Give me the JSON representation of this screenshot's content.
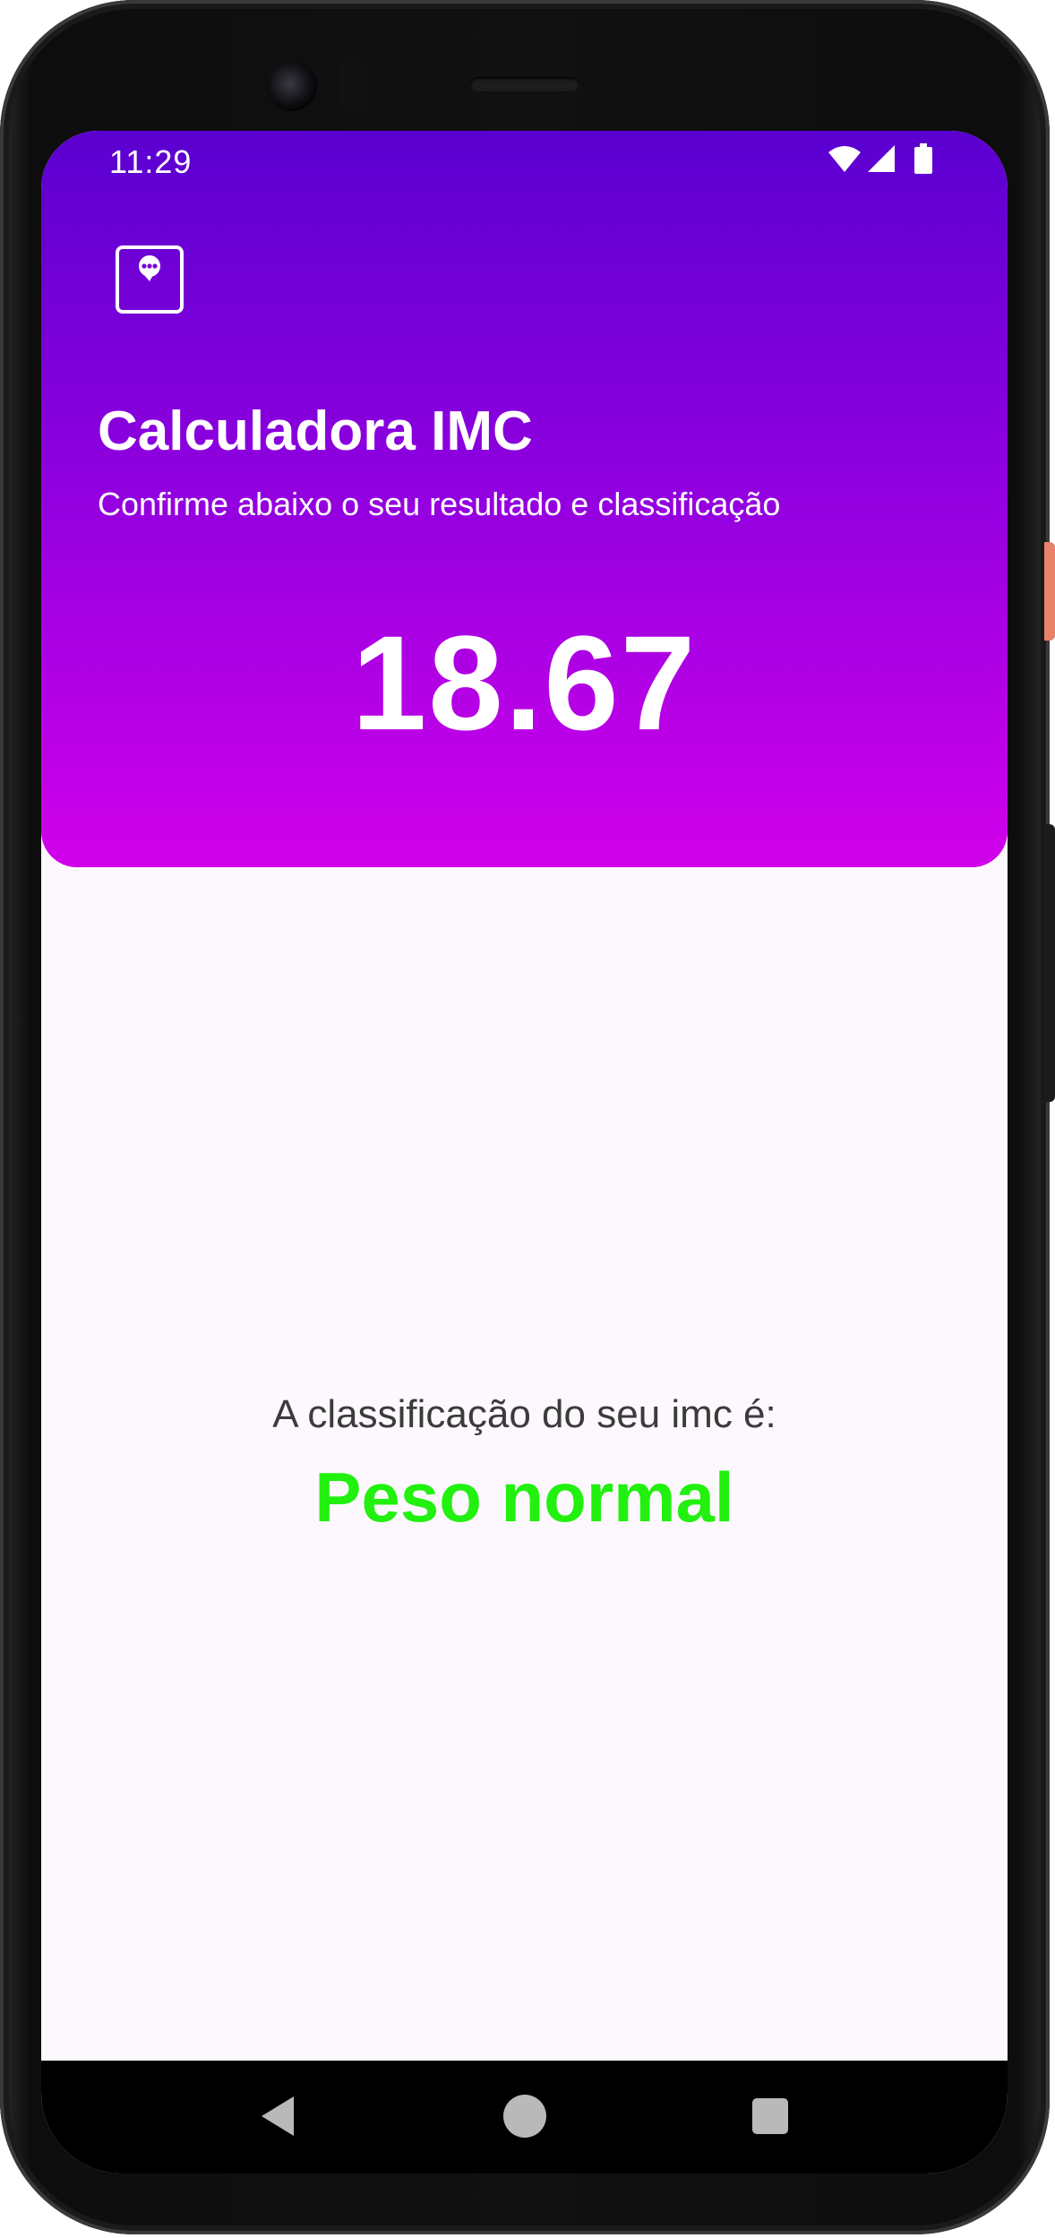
{
  "status_bar": {
    "time": "11:29",
    "icons": [
      "wifi-icon",
      "signal-icon",
      "battery-icon"
    ]
  },
  "header": {
    "app_icon": "chat-bubble-icon",
    "title": "Calculadora IMC",
    "subtitle": "Confirme abaixo o seu resultado e classificação",
    "imc_value": "18.67",
    "gradient_top": "#5a00d0",
    "gradient_bottom": "#d000ea"
  },
  "result": {
    "label": "A classificação do seu imc é:",
    "classification": "Peso normal",
    "classification_color": "#22f00f"
  },
  "nav_bar": {
    "buttons": [
      "back-icon",
      "home-icon",
      "recents-icon"
    ]
  }
}
